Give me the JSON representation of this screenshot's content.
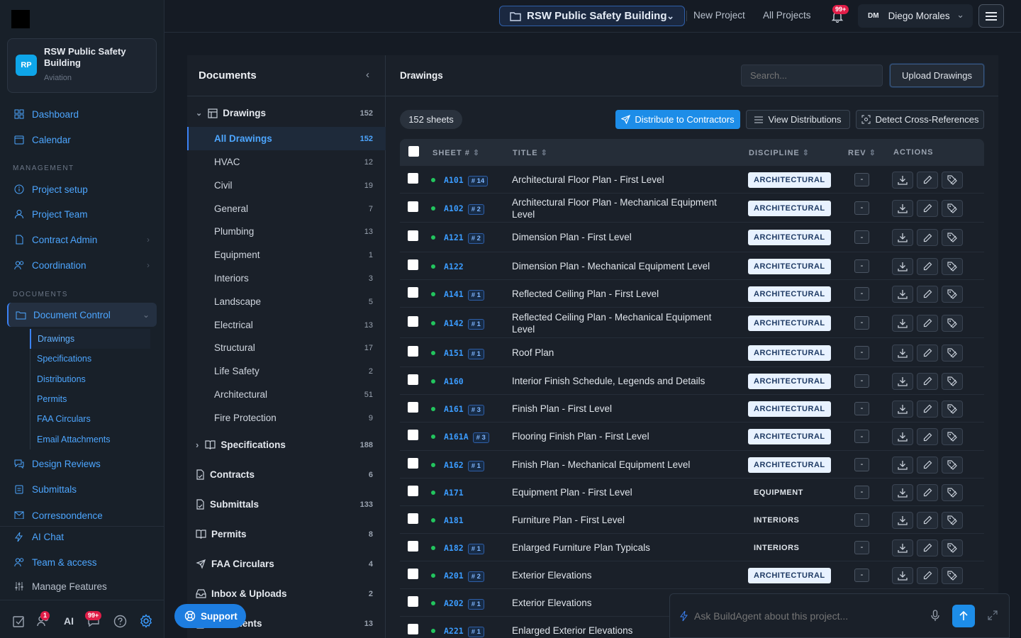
{
  "project": {
    "initials": "RP",
    "name": "RSW Public Safety Building",
    "type": "Aviation"
  },
  "nav": {
    "dashboard": "Dashboard",
    "calendar": "Calendar",
    "management_label": "MANAGEMENT",
    "project_setup": "Project setup",
    "project_team": "Project Team",
    "contract_admin": "Contract Admin",
    "coordination": "Coordination",
    "documents_label": "DOCUMENTS",
    "document_control": "Document Control",
    "sub": [
      "Drawings",
      "Specifications",
      "Distributions",
      "Permits",
      "FAA Circulars",
      "Email Attachments"
    ],
    "design_reviews": "Design Reviews",
    "submittals": "Submittals",
    "correspondence": "Correspondence",
    "ai_chat": "AI Chat",
    "team_access": "Team & access",
    "manage_features": "Manage Features"
  },
  "footer": {
    "ai": "AI",
    "badge_tasks": "1",
    "badge_ai": "99+"
  },
  "topbar": {
    "project": "RSW Public Safety Building",
    "new_project": "New Project",
    "all_projects": "All Projects",
    "notif_badge": "99+",
    "user_initials": "DM",
    "user_name": "Diego Morales"
  },
  "docpanel": {
    "title": "Documents",
    "drawings": {
      "label": "Drawings",
      "count": "152"
    },
    "items": [
      {
        "label": "All Drawings",
        "count": "152"
      },
      {
        "label": "HVAC",
        "count": "12"
      },
      {
        "label": "Civil",
        "count": "19"
      },
      {
        "label": "General",
        "count": "7"
      },
      {
        "label": "Plumbing",
        "count": "13"
      },
      {
        "label": "Equipment",
        "count": "1"
      },
      {
        "label": "Interiors",
        "count": "3"
      },
      {
        "label": "Landscape",
        "count": "5"
      },
      {
        "label": "Electrical",
        "count": "13"
      },
      {
        "label": "Structural",
        "count": "17"
      },
      {
        "label": "Life Safety",
        "count": "2"
      },
      {
        "label": "Architectural",
        "count": "51"
      },
      {
        "label": "Fire Protection",
        "count": "9"
      }
    ],
    "groups": [
      {
        "label": "Specifications",
        "count": "188"
      },
      {
        "label": "Contracts",
        "count": "6"
      },
      {
        "label": "Submittals",
        "count": "133"
      },
      {
        "label": "Permits",
        "count": "8"
      },
      {
        "label": "FAA Circulars",
        "count": "4"
      },
      {
        "label": "Inbox & Uploads",
        "count": "2"
      },
      {
        "label": "Documents",
        "count": "13"
      }
    ]
  },
  "main": {
    "title": "Drawings",
    "search_placeholder": "Search...",
    "upload": "Upload Drawings",
    "sheet_count": "152 sheets",
    "distribute": "Distribute to Contractors",
    "view_dist": "View Distributions",
    "detect": "Detect Cross-References",
    "headers": {
      "sheet": "SHEET #",
      "title": "TITLE",
      "discipline": "DISCIPLINE",
      "rev": "REV",
      "actions": "ACTIONS"
    }
  },
  "rows": [
    {
      "sheet": "A101",
      "revs": "# 14",
      "title": "Architectural Floor Plan - First Level",
      "disc": "ARCHITECTURAL",
      "rev": "-"
    },
    {
      "sheet": "A102",
      "revs": "# 2",
      "title": "Architectural Floor Plan - Mechanical Equipment Level",
      "disc": "ARCHITECTURAL",
      "rev": "-"
    },
    {
      "sheet": "A121",
      "revs": "# 2",
      "title": "Dimension Plan - First Level",
      "disc": "ARCHITECTURAL",
      "rev": "-"
    },
    {
      "sheet": "A122",
      "revs": "",
      "title": "Dimension Plan - Mechanical Equipment Level",
      "disc": "ARCHITECTURAL",
      "rev": "-"
    },
    {
      "sheet": "A141",
      "revs": "# 1",
      "title": "Reflected Ceiling Plan - First Level",
      "disc": "ARCHITECTURAL",
      "rev": "-"
    },
    {
      "sheet": "A142",
      "revs": "# 1",
      "title": "Reflected Ceiling Plan - Mechanical Equipment Level",
      "disc": "ARCHITECTURAL",
      "rev": "-"
    },
    {
      "sheet": "A151",
      "revs": "# 1",
      "title": "Roof Plan",
      "disc": "ARCHITECTURAL",
      "rev": "-"
    },
    {
      "sheet": "A160",
      "revs": "",
      "title": "Interior Finish Schedule, Legends and Details",
      "disc": "ARCHITECTURAL",
      "rev": "-"
    },
    {
      "sheet": "A161",
      "revs": "# 3",
      "title": "Finish Plan - First Level",
      "disc": "ARCHITECTURAL",
      "rev": "-"
    },
    {
      "sheet": "A161A",
      "revs": "# 3",
      "title": "Flooring Finish Plan - First Level",
      "disc": "ARCHITECTURAL",
      "rev": "-"
    },
    {
      "sheet": "A162",
      "revs": "# 1",
      "title": "Finish Plan - Mechanical Equipment Level",
      "disc": "ARCHITECTURAL",
      "rev": "-"
    },
    {
      "sheet": "A171",
      "revs": "",
      "title": "Equipment Plan - First Level",
      "disc": "EQUIPMENT",
      "rev": "-"
    },
    {
      "sheet": "A181",
      "revs": "",
      "title": "Furniture Plan - First Level",
      "disc": "INTERIORS",
      "rev": "-"
    },
    {
      "sheet": "A182",
      "revs": "# 1",
      "title": "Enlarged Furniture Plan Typicals",
      "disc": "INTERIORS",
      "rev": "-"
    },
    {
      "sheet": "A201",
      "revs": "# 2",
      "title": "Exterior Elevations",
      "disc": "ARCHITECTURAL",
      "rev": "-"
    },
    {
      "sheet": "A202",
      "revs": "# 1",
      "title": "Exterior Elevations",
      "disc": "",
      "rev": "-"
    },
    {
      "sheet": "A221",
      "revs": "# 1",
      "title": "Enlarged Exterior Elevations",
      "disc": "",
      "rev": "-"
    }
  ],
  "support": "Support",
  "ask_placeholder": "Ask BuildAgent about this project..."
}
